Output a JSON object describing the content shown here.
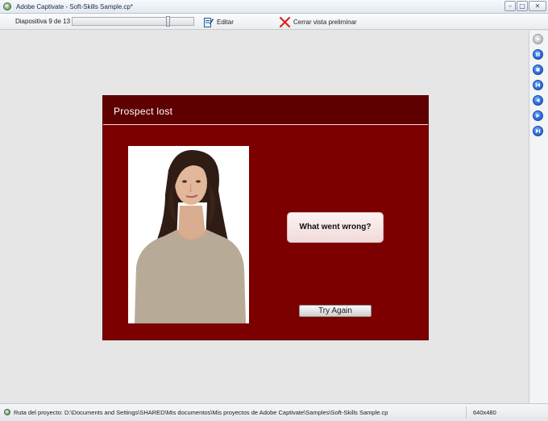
{
  "window": {
    "title": "Adobe Captivate - Soft-Skills Sample.cp*",
    "controls": {
      "minimize": "–",
      "maximize": "□",
      "close": "✕"
    }
  },
  "toolbar": {
    "slide_counter": "Diapositiva 9 de 13",
    "progress": 0.8,
    "edit_label": "Editar",
    "close_preview_label": "Cerrar vista preliminar",
    "edit_icon": "edit-slide-icon",
    "close_preview_icon": "red-x-icon"
  },
  "playback_controls": [
    {
      "name": "play",
      "icon": "play-icon",
      "enabled": false
    },
    {
      "name": "pause",
      "icon": "pause-icon",
      "enabled": true
    },
    {
      "name": "stop",
      "icon": "stop-icon",
      "enabled": true
    },
    {
      "name": "first-slide",
      "icon": "first-slide-icon",
      "enabled": true
    },
    {
      "name": "previous-slide",
      "icon": "previous-slide-icon",
      "enabled": true
    },
    {
      "name": "next-slide",
      "icon": "next-slide-icon",
      "enabled": true
    },
    {
      "name": "last-slide",
      "icon": "last-slide-icon",
      "enabled": true
    }
  ],
  "slide": {
    "title": "Prospect lost",
    "question_button": "What went wrong?",
    "try_again_button": "Try Again",
    "colors": {
      "background": "#7c0000",
      "header": "#5e0000"
    }
  },
  "status": {
    "path": "Ruta del proyecto: D:\\Documents and Settings\\SHARED\\Mis documentos\\Mis proyectos de Adobe Captivate\\Samples\\Soft-Skills Sample.cp",
    "resolution": "640x480"
  }
}
